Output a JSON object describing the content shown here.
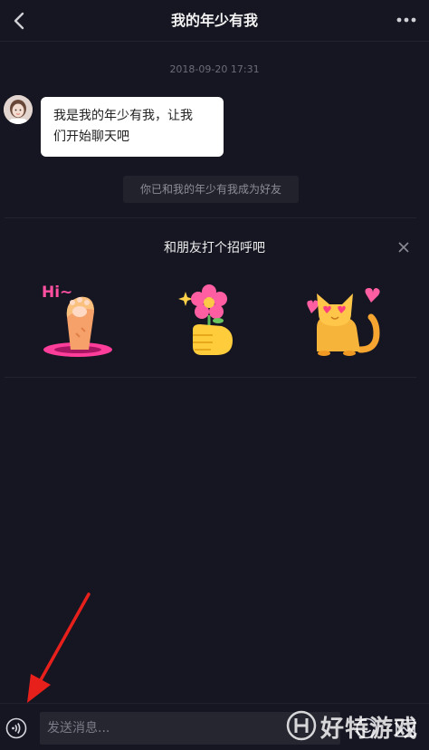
{
  "header": {
    "title": "我的年少有我",
    "back_icon": "chevron-left-icon",
    "more_icon": "more-dots-icon"
  },
  "chat": {
    "timestamp": "2018-09-20 17:31",
    "message": {
      "line1": "我是我的年少有我，让我",
      "line2": "们开始聊天吧"
    },
    "system_note": "你已和我的年少有我成为好友"
  },
  "greeting": {
    "title": "和朋友打个招呼吧",
    "stickers": [
      {
        "name": "hi-paw-sticker",
        "text": "Hi~"
      },
      {
        "name": "flower-hand-sticker"
      },
      {
        "name": "love-cat-sticker"
      }
    ]
  },
  "input_bar": {
    "placeholder": "发送消息...",
    "voice_icon": "voice-icon",
    "emoji_icon": "emoji-icon",
    "image_icon": "image-icon"
  },
  "watermark": {
    "text": "好特游戏"
  },
  "colors": {
    "background": "#161622",
    "bubble": "#ffffff",
    "annotation_arrow": "#e8201c",
    "accent_pink": "#ff5fa2",
    "accent_orange": "#f7a531"
  }
}
